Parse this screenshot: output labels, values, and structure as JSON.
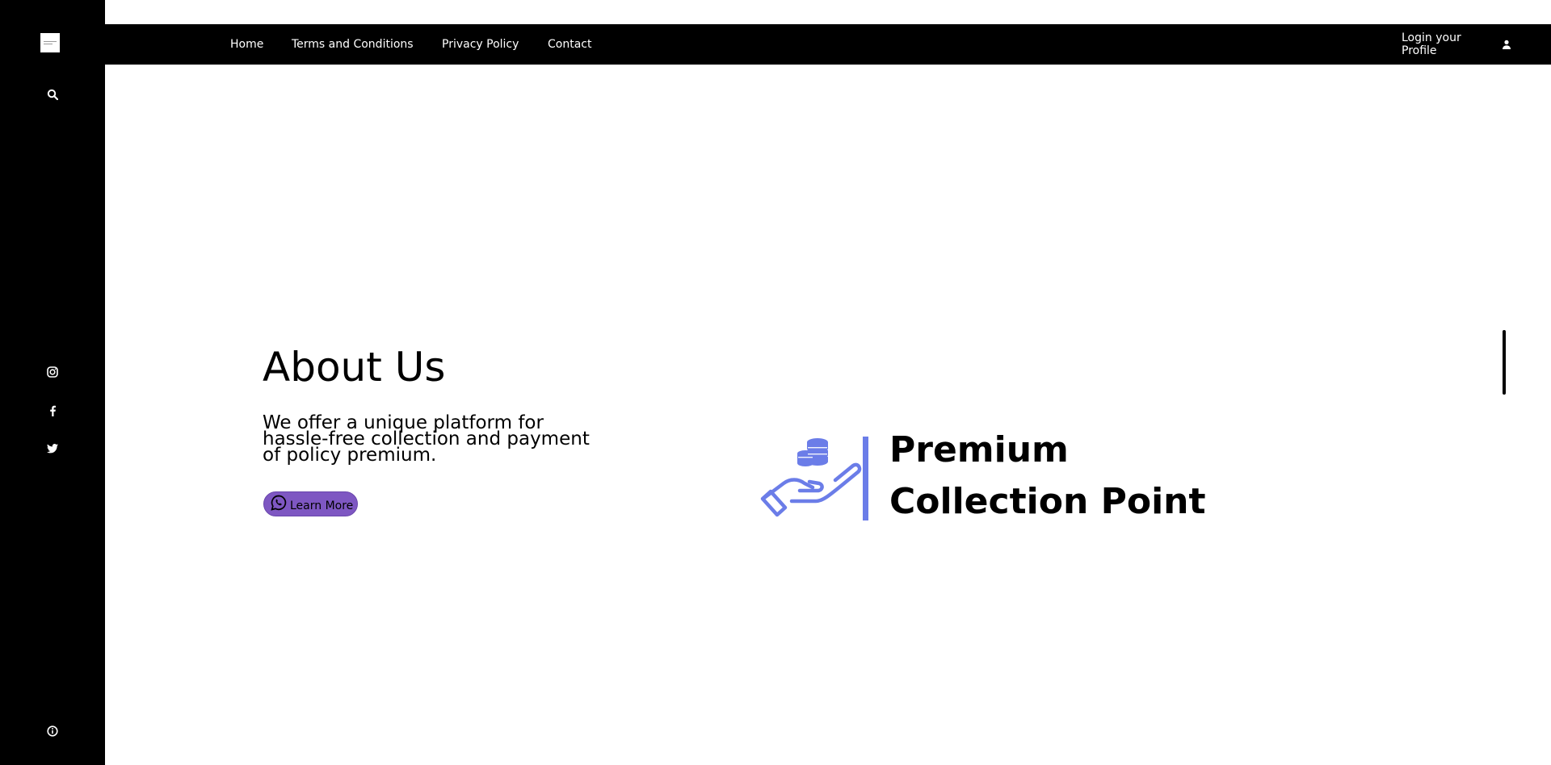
{
  "nav": {
    "links": [
      "Home",
      "Terms and Conditions",
      "Privacy Policy",
      "Contact"
    ],
    "login_label": "Login your Profile"
  },
  "sidebar": {
    "icons": [
      "search-icon",
      "instagram-icon",
      "facebook-icon",
      "twitter-icon",
      "info-icon"
    ]
  },
  "hero": {
    "title": "About Us",
    "description": "We offer a unique platform for hassle-free collection and payment of policy premium.",
    "button_label": "Learn More",
    "button_icon": "whatsapp-icon"
  },
  "brand": {
    "line1": "Premium",
    "line2": "Collection Point",
    "accent_color": "#6b7de8"
  },
  "colors": {
    "sidebar_bg": "#000000",
    "nav_bg": "#000000",
    "button_bg": "#7e57c2"
  }
}
